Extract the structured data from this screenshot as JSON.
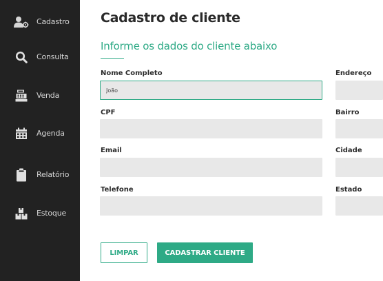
{
  "sidebar": {
    "items": [
      {
        "label": "Cadastro",
        "icon": "user-add-icon"
      },
      {
        "label": "Consulta",
        "icon": "search-icon"
      },
      {
        "label": "Venda",
        "icon": "cash-register-icon"
      },
      {
        "label": "Agenda",
        "icon": "calendar-icon"
      },
      {
        "label": "Relatório",
        "icon": "clipboard-icon"
      },
      {
        "label": "Estoque",
        "icon": "boxes-icon"
      }
    ]
  },
  "main": {
    "title": "Cadastro de cliente",
    "subtitle": "Informe os dados do cliente abaixo",
    "fields": {
      "nome": {
        "label": "Nome Completo",
        "value": "João"
      },
      "cpf": {
        "label": "CPF",
        "value": ""
      },
      "email": {
        "label": "Email",
        "value": ""
      },
      "telefone": {
        "label": "Telefone",
        "value": ""
      },
      "endereco": {
        "label": "Endereço",
        "value": ""
      },
      "bairro": {
        "label": "Bairro",
        "value": ""
      },
      "cidade": {
        "label": "Cidade",
        "value": ""
      },
      "estado": {
        "label": "Estado",
        "value": ""
      }
    },
    "buttons": {
      "clear": "LIMPAR",
      "submit": "CADASTRAR CLIENTE"
    }
  },
  "colors": {
    "accent": "#2eaa86",
    "sidebar_bg": "#222222",
    "input_bg": "#e8e8e8"
  }
}
